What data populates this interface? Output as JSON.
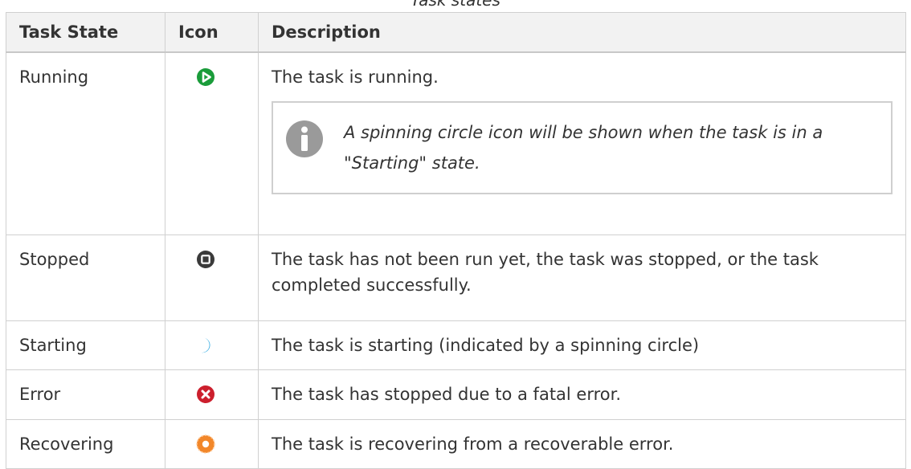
{
  "caption": "Task states",
  "table": {
    "headers": [
      "Task State",
      "Icon",
      "Description"
    ],
    "rows": [
      {
        "state": "Running",
        "icon": "running-play-icon",
        "description": "The task is running.",
        "note": "A spinning circle icon will be shown when the task is in a \"Starting\" state."
      },
      {
        "state": "Stopped",
        "icon": "stopped-square-icon",
        "description": "The task has not been run yet, the task was stopped, or the task completed successfully."
      },
      {
        "state": "Starting",
        "icon": "starting-spinner-icon",
        "description": "The task is starting (indicated by a spinning circle)"
      },
      {
        "state": "Error",
        "icon": "error-x-icon",
        "description": "The task has stopped due to a fatal error."
      },
      {
        "state": "Recovering",
        "icon": "recovering-gear-icon",
        "description": "The task is recovering from a recoverable error."
      }
    ]
  },
  "colors": {
    "running": "#1a9c3a",
    "stopped": "#3a3a3a",
    "starting": "#27a6e0",
    "error": "#cc1f2d",
    "recovering": "#f2872a",
    "note_icon": "#9a9a9a",
    "header_bg": "#f2f2f2",
    "border": "#d0d0d0"
  }
}
